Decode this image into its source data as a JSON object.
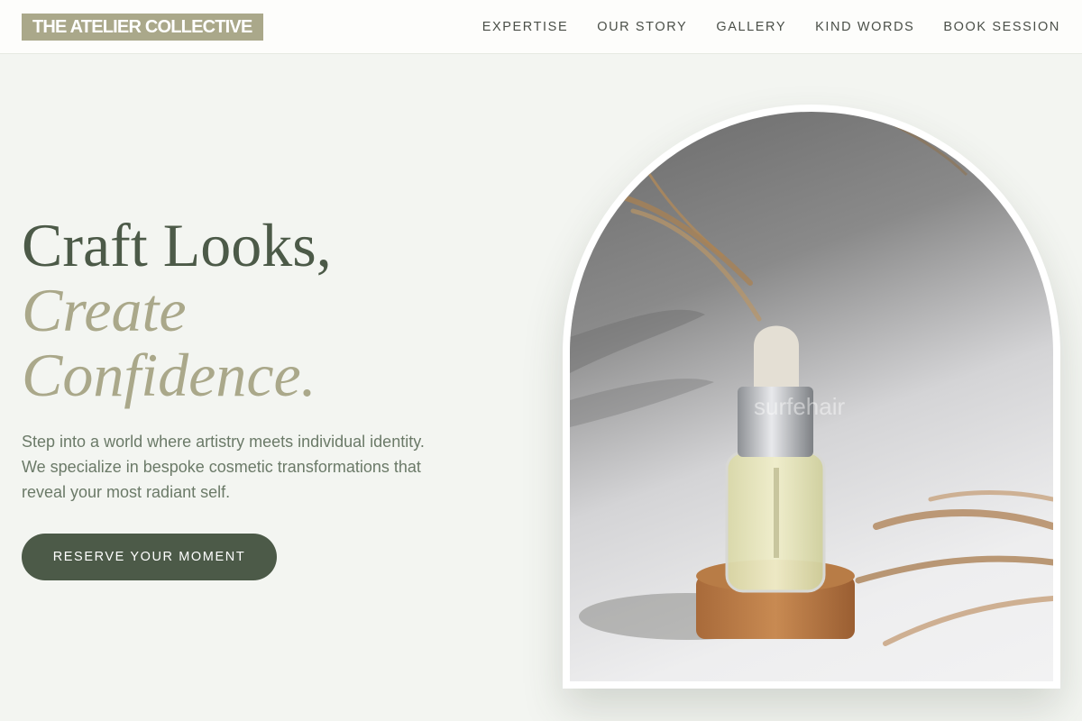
{
  "header": {
    "logo": "THE ATELIER COLLECTIVE",
    "nav": [
      {
        "label": "EXPERTISE"
      },
      {
        "label": "OUR STORY"
      },
      {
        "label": "GALLERY"
      },
      {
        "label": "KIND WORDS"
      },
      {
        "label": "BOOK SESSION"
      }
    ]
  },
  "hero": {
    "title_line1": "Craft Looks,",
    "title_line2": "Create",
    "title_line3": "Confidence.",
    "description": "Step into a world where artistry meets individual identity. We specialize in bespoke cosmetic transformations that reveal your most radiant self.",
    "cta_label": "RESERVE YOUR MOMENT"
  },
  "image": {
    "watermark": "surfehair",
    "icon": "serum-bottle-photo"
  },
  "colors": {
    "accent_dark": "#4c5a48",
    "accent_khaki": "#aaa88a",
    "background": "#f3f5f1"
  }
}
